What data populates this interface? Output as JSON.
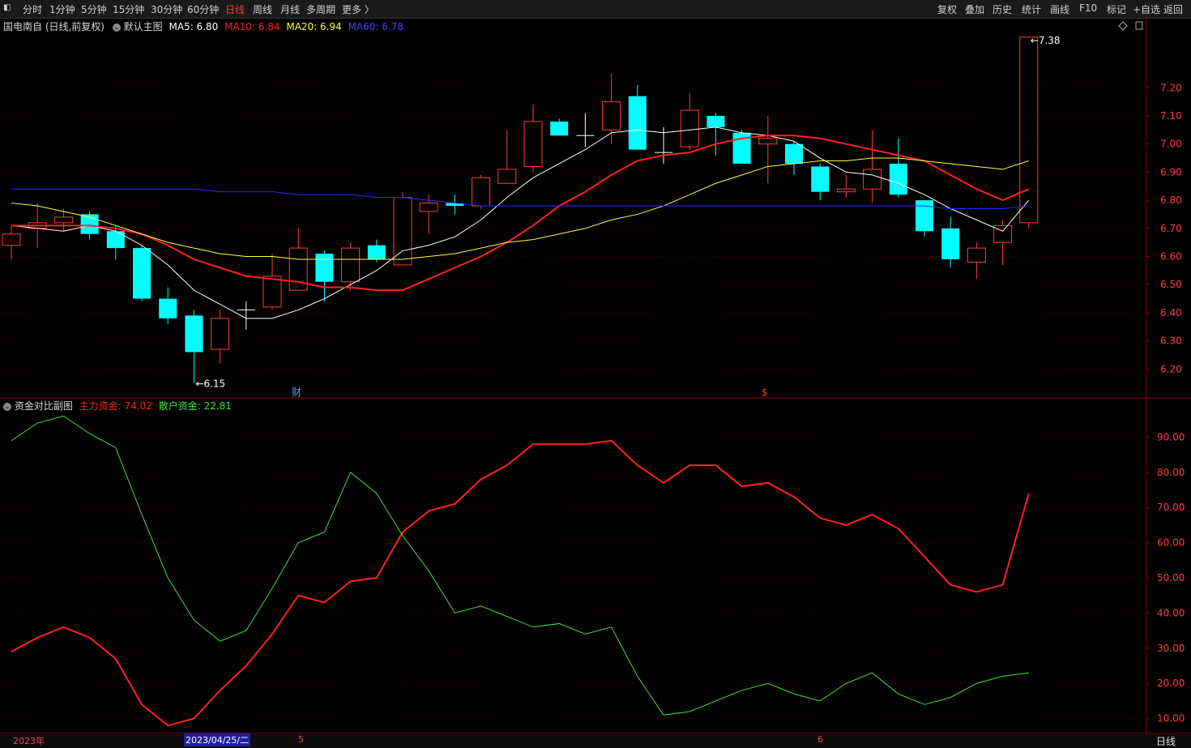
{
  "toolbar": {
    "periods": [
      "分时",
      "1分钟",
      "5分钟",
      "15分钟",
      "30分钟",
      "60分钟",
      "日线",
      "周线",
      "月线",
      "多周期",
      "更多 〉"
    ],
    "active": "日线",
    "right": [
      "复权",
      "叠加",
      "历史",
      "统计",
      "画线",
      "F10",
      "标记",
      "+自选",
      "返回"
    ]
  },
  "main": {
    "stock": "国电南自 (日线,前复权)",
    "template": "默认主图",
    "ma": [
      {
        "label": "MA5: 6.80",
        "color": "#ffffff"
      },
      {
        "label": "MA10: 6.84",
        "color": "#ff2020"
      },
      {
        "label": "MA20: 6.94",
        "color": "#ffff40"
      },
      {
        "label": "MA60: 6.78",
        "color": "#2a2aff"
      }
    ],
    "high_label": "7.38",
    "low_label": "6.15",
    "markers": [
      {
        "text": "财",
        "color": "#4aa3ff"
      },
      {
        "text": "$",
        "color": "#ff3c3c"
      }
    ]
  },
  "sub": {
    "title": "资金对比副图",
    "main_label": "主力资金: 74.02",
    "retail_label": "散户资金: 22.81"
  },
  "bottom": {
    "dates": [
      "2023年",
      "2023/04/25/二",
      "5",
      "6"
    ],
    "right": "日线"
  },
  "chart_data": [
    {
      "type": "candlestick",
      "y_ticks": [
        6.2,
        6.3,
        6.4,
        6.5,
        6.6,
        6.7,
        6.8,
        6.9,
        7.0,
        7.1,
        7.2
      ],
      "ylim": [
        6.1,
        7.44
      ],
      "candles": [
        {
          "o": 6.64,
          "c": 6.68,
          "h": 6.71,
          "l": 6.59
        },
        {
          "o": 6.7,
          "c": 6.72,
          "h": 6.79,
          "l": 6.63
        },
        {
          "o": 6.72,
          "c": 6.74,
          "h": 6.77,
          "l": 6.69
        },
        {
          "o": 6.75,
          "c": 6.68,
          "h": 6.76,
          "l": 6.66
        },
        {
          "o": 6.69,
          "c": 6.63,
          "h": 6.71,
          "l": 6.59
        },
        {
          "o": 6.63,
          "c": 6.45,
          "h": 6.64,
          "l": 6.44
        },
        {
          "o": 6.45,
          "c": 6.38,
          "h": 6.49,
          "l": 6.36
        },
        {
          "o": 6.39,
          "c": 6.26,
          "h": 6.41,
          "l": 6.15
        },
        {
          "o": 6.27,
          "c": 6.38,
          "h": 6.41,
          "l": 6.22
        },
        {
          "o": 6.41,
          "c": 6.41,
          "h": 6.44,
          "l": 6.34
        },
        {
          "o": 6.42,
          "c": 6.53,
          "h": 6.61,
          "l": 6.41
        },
        {
          "o": 6.48,
          "c": 6.63,
          "h": 6.7,
          "l": 6.48
        },
        {
          "o": 6.61,
          "c": 6.51,
          "h": 6.62,
          "l": 6.44
        },
        {
          "o": 6.51,
          "c": 6.63,
          "h": 6.65,
          "l": 6.48
        },
        {
          "o": 6.64,
          "c": 6.59,
          "h": 6.66,
          "l": 6.58
        },
        {
          "o": 6.57,
          "c": 6.81,
          "h": 6.83,
          "l": 6.57
        },
        {
          "o": 6.76,
          "c": 6.79,
          "h": 6.82,
          "l": 6.68
        },
        {
          "o": 6.79,
          "c": 6.78,
          "h": 6.82,
          "l": 6.75
        },
        {
          "o": 6.78,
          "c": 6.88,
          "h": 6.89,
          "l": 6.77
        },
        {
          "o": 6.86,
          "c": 6.91,
          "h": 7.05,
          "l": 6.86
        },
        {
          "o": 6.92,
          "c": 7.08,
          "h": 7.14,
          "l": 6.9
        },
        {
          "o": 7.08,
          "c": 7.03,
          "h": 7.09,
          "l": 7.03
        },
        {
          "o": 7.03,
          "c": 7.03,
          "h": 7.11,
          "l": 6.99
        },
        {
          "o": 7.05,
          "c": 7.15,
          "h": 7.25,
          "l": 7.0
        },
        {
          "o": 7.17,
          "c": 6.98,
          "h": 7.21,
          "l": 6.98
        },
        {
          "o": 6.97,
          "c": 6.97,
          "h": 7.06,
          "l": 6.93
        },
        {
          "o": 6.99,
          "c": 7.12,
          "h": 7.18,
          "l": 6.98
        },
        {
          "o": 7.1,
          "c": 7.06,
          "h": 7.11,
          "l": 6.96
        },
        {
          "o": 7.04,
          "c": 6.93,
          "h": 7.05,
          "l": 6.93
        },
        {
          "o": 7.0,
          "c": 7.02,
          "h": 7.1,
          "l": 6.86
        },
        {
          "o": 7.0,
          "c": 6.93,
          "h": 7.01,
          "l": 6.89
        },
        {
          "o": 6.92,
          "c": 6.83,
          "h": 6.93,
          "l": 6.8
        },
        {
          "o": 6.83,
          "c": 6.84,
          "h": 6.89,
          "l": 6.81
        },
        {
          "o": 6.84,
          "c": 6.91,
          "h": 7.05,
          "l": 6.79
        },
        {
          "o": 6.93,
          "c": 6.82,
          "h": 7.02,
          "l": 6.81
        },
        {
          "o": 6.8,
          "c": 6.69,
          "h": 6.8,
          "l": 6.67
        },
        {
          "o": 6.7,
          "c": 6.59,
          "h": 6.74,
          "l": 6.56
        },
        {
          "o": 6.58,
          "c": 6.63,
          "h": 6.65,
          "l": 6.52
        },
        {
          "o": 6.65,
          "c": 6.71,
          "h": 6.73,
          "l": 6.57
        },
        {
          "o": 6.72,
          "c": 7.38,
          "h": 7.38,
          "l": 6.7
        }
      ],
      "series": [
        {
          "name": "MA5",
          "color": "#ffffff",
          "values": [
            6.71,
            6.7,
            6.69,
            6.71,
            6.69,
            6.64,
            6.57,
            6.48,
            6.43,
            6.38,
            6.38,
            6.41,
            6.45,
            6.5,
            6.55,
            6.62,
            6.64,
            6.67,
            6.73,
            6.81,
            6.88,
            6.93,
            6.98,
            7.04,
            7.05,
            7.04,
            7.05,
            7.06,
            7.04,
            7.03,
            7.01,
            6.95,
            6.9,
            6.89,
            6.86,
            6.82,
            6.77,
            6.73,
            6.69,
            6.8
          ]
        },
        {
          "name": "MA10",
          "color": "#ff2020",
          "values": [
            6.71,
            6.71,
            6.71,
            6.71,
            6.7,
            6.68,
            6.64,
            6.59,
            6.56,
            6.53,
            6.52,
            6.51,
            6.49,
            6.49,
            6.48,
            6.48,
            6.52,
            6.56,
            6.6,
            6.65,
            6.71,
            6.78,
            6.83,
            6.89,
            6.94,
            6.96,
            6.97,
            7.0,
            7.02,
            7.03,
            7.03,
            7.02,
            7.0,
            6.98,
            6.96,
            6.94,
            6.89,
            6.84,
            6.8,
            6.84
          ]
        },
        {
          "name": "MA20",
          "color": "#ffff40",
          "values": [
            6.79,
            6.78,
            6.76,
            6.74,
            6.71,
            6.68,
            6.65,
            6.63,
            6.61,
            6.6,
            6.6,
            6.59,
            6.59,
            6.59,
            6.59,
            6.59,
            6.6,
            6.61,
            6.63,
            6.65,
            6.66,
            6.68,
            6.7,
            6.73,
            6.75,
            6.78,
            6.82,
            6.86,
            6.89,
            6.92,
            6.93,
            6.94,
            6.94,
            6.95,
            6.95,
            6.94,
            6.93,
            6.92,
            6.91,
            6.94
          ]
        },
        {
          "name": "MA60",
          "color": "#2a2aff",
          "values": [
            6.84,
            6.84,
            6.84,
            6.84,
            6.84,
            6.84,
            6.84,
            6.84,
            6.83,
            6.83,
            6.83,
            6.82,
            6.82,
            6.82,
            6.81,
            6.81,
            6.8,
            6.79,
            6.78,
            6.78,
            6.78,
            6.78,
            6.78,
            6.78,
            6.78,
            6.78,
            6.78,
            6.78,
            6.78,
            6.78,
            6.78,
            6.78,
            6.78,
            6.78,
            6.78,
            6.78,
            6.77,
            6.77,
            6.77,
            6.78
          ]
        }
      ]
    },
    {
      "type": "line",
      "y_ticks": [
        10,
        20,
        30,
        40,
        50,
        60,
        70,
        80,
        90
      ],
      "ylim": [
        6,
        100
      ],
      "series": [
        {
          "name": "主力资金",
          "color": "#ff2020",
          "values": [
            29,
            33,
            36,
            33,
            27,
            14,
            8,
            10,
            18,
            25,
            34,
            45,
            43,
            49,
            50,
            63,
            69,
            71,
            78,
            82,
            88,
            88,
            88,
            89,
            82,
            77,
            82,
            82,
            76,
            77,
            73,
            67,
            65,
            68,
            64,
            56,
            48,
            46,
            48,
            74
          ]
        },
        {
          "name": "散户资金",
          "color": "#40e040",
          "values": [
            89,
            94,
            96,
            91,
            87,
            68,
            50,
            38,
            32,
            35,
            47,
            60,
            63,
            80,
            74,
            62,
            52,
            40,
            42,
            39,
            36,
            37,
            34,
            36,
            22,
            11,
            12,
            15,
            18,
            20,
            17,
            15,
            20,
            23,
            17,
            14,
            16,
            20,
            22,
            23
          ]
        }
      ]
    }
  ]
}
